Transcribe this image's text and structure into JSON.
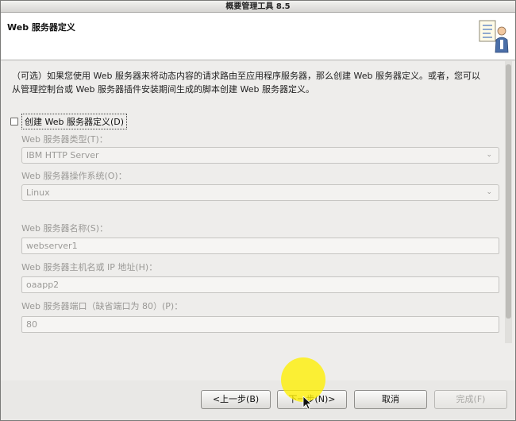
{
  "window": {
    "title": "概要管理工具 8.5"
  },
  "header": {
    "title": "Web 服务器定义"
  },
  "intro": {
    "line1": "（可选）如果您使用 Web 服务器来将动态内容的请求路由至应用程序服务器，那么创建 Web 服务器定义。或者，您可以",
    "line2": "从管理控制台或 Web 服务器插件安装期间生成的脚本创建 Web 服务器定义。"
  },
  "create_checkbox": {
    "label": "创建 Web 服务器定义(D)",
    "checked": false
  },
  "fields": {
    "server_type": {
      "label": "Web 服务器类型(T)：",
      "value": "IBM HTTP Server"
    },
    "server_os": {
      "label": "Web 服务器操作系统(O)：",
      "value": "Linux"
    },
    "server_name": {
      "label": "Web 服务器名称(S)：",
      "value": "webserver1"
    },
    "host_name": {
      "label": "Web 服务器主机名或 IP 地址(H)：",
      "value": "oaapp2"
    },
    "port": {
      "label": "Web 服务器端口（缺省端口为 80）(P)：",
      "value": "80"
    }
  },
  "buttons": {
    "back": "<上一步(B)",
    "next": "下一步(N)>",
    "cancel": "取消",
    "finish": "完成(F)"
  },
  "icons": {
    "header": "wizard-document-person-icon",
    "dropdown": "chevron-down-icon",
    "cursor": "mouse-pointer-icon"
  },
  "colors": {
    "highlight": "#fff000",
    "header_bg": "#ffffff",
    "window_bg": "#e9e8e6"
  }
}
